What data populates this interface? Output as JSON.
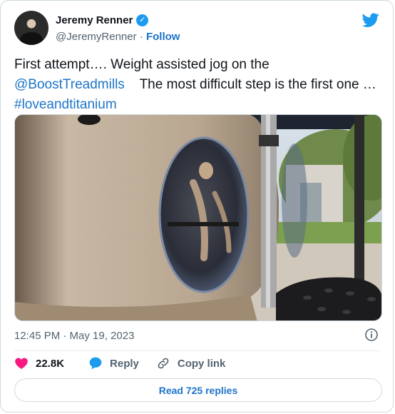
{
  "author": {
    "name": "Jeremy Renner",
    "handle": "@JeremyRenner",
    "separator": "·",
    "follow_label": "Follow",
    "verified": true,
    "avatar_icon": "profile-photo"
  },
  "brand_icon": "twitter-bird-icon",
  "tweet": {
    "text_part1": "First attempt…. Weight assisted jog on the",
    "mention": "@BoostTreadmills",
    "text_part2": "    The most difficult step is the first one …",
    "hashtag": "#loveandtitanium"
  },
  "timestamp": "12:45 PM · May 19, 2023",
  "actions": {
    "like_count": "22.8K",
    "reply_label": "Reply",
    "copy_link_label": "Copy link"
  },
  "read_replies_label": "Read 725 replies",
  "colors": {
    "link": "#1d74c9",
    "twitter_blue": "#1d9bf0",
    "like_pink": "#f91880",
    "secondary_text": "#536471"
  }
}
